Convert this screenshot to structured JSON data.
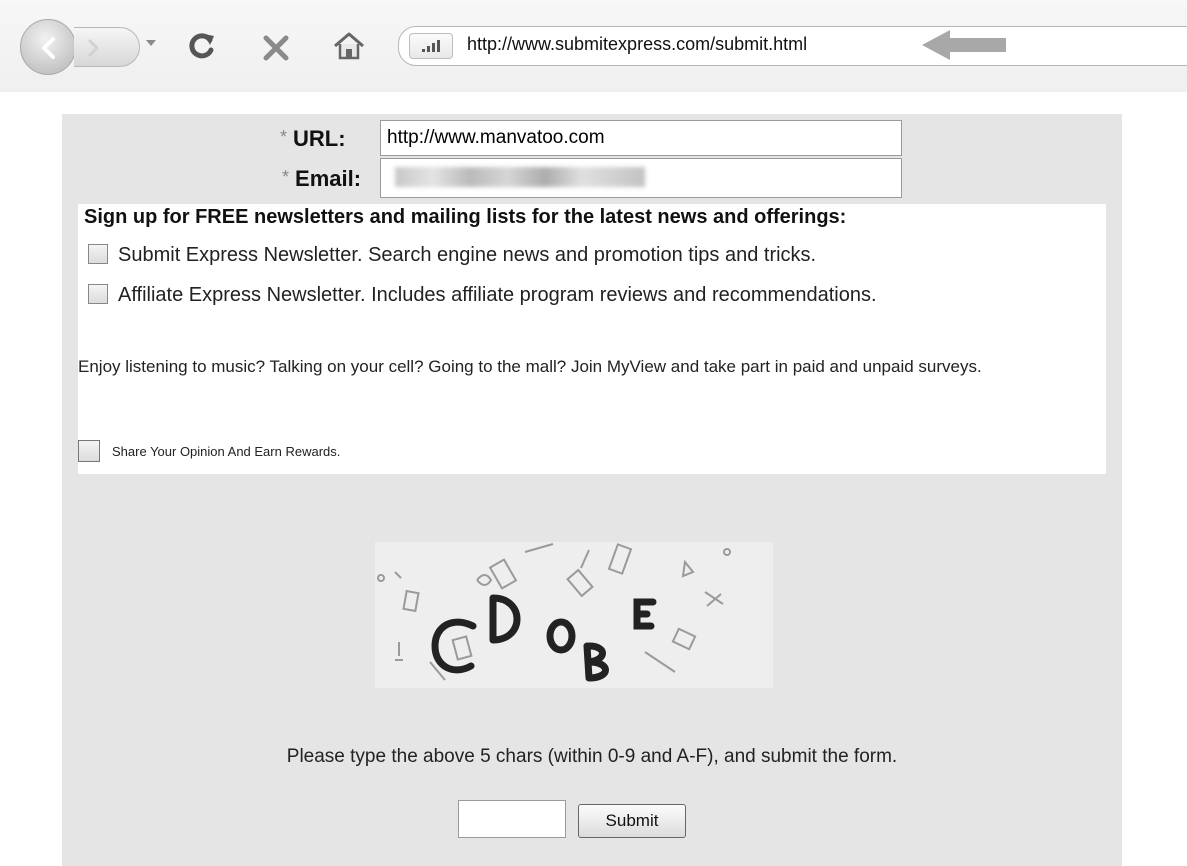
{
  "browser": {
    "address_url": "http://www.submitexpress.com/submit.html"
  },
  "form": {
    "url_label": "URL:",
    "url_required_mark": "*",
    "url_value": "http://www.manvatoo.com",
    "email_label": "Email:",
    "email_required_mark": "*",
    "newsletter_heading": "Sign up for FREE newsletters and mailing lists for the latest news and offerings:",
    "newsletters": [
      {
        "label": "Submit Express Newsletter. Search engine news and promotion tips and tricks.",
        "checked": false
      },
      {
        "label": "Affiliate Express Newsletter. Includes affiliate program reviews and recommendations.",
        "checked": false
      }
    ],
    "promo_text": "Enjoy listening to music? Talking on your cell? Going to the mall? Join MyView and take part in paid and unpaid surveys.",
    "share_label": "Share Your Opinion And Earn Rewards.",
    "captcha_chars": [
      "C",
      "D",
      "O",
      "B",
      "E"
    ],
    "captcha_instruction": "Please type the above 5 chars (within 0-9 and A-F), and submit the form.",
    "submit_label": "Submit"
  },
  "colors": {
    "panel_bg": "#e5e5e5",
    "annotation_arrow": "#a8a8a8"
  }
}
